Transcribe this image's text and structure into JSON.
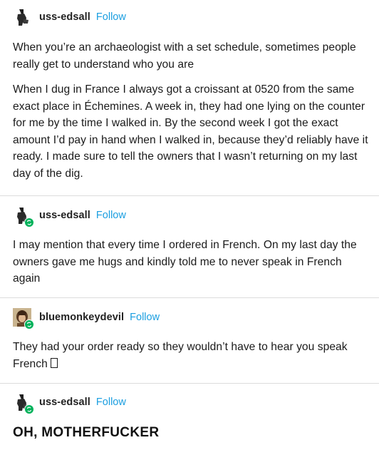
{
  "posts": [
    {
      "username": "uss-edsall",
      "follow_label": "Follow",
      "avatar_icon": "dark-figure-avatar-icon",
      "reblogged": false,
      "paragraphs": [
        "When you’re an archaeologist with a set schedule, sometimes people really get to understand who you are",
        "When I dug in France I always got a croissant at 0520 from the same exact place in Échemines. A week in, they had one lying on the counter for me by the time I walked in. By the second week I got the exact amount I’d pay in hand when I walked in, because they’d reliably have it ready. I made sure to tell the owners that I wasn’t returning on my last day of the dig."
      ]
    },
    {
      "username": "uss-edsall",
      "follow_label": "Follow",
      "avatar_icon": "dark-figure-avatar-icon",
      "reblogged": true,
      "paragraphs": [
        "I may mention that every time I ordered in French. On my last day the owners gave me hugs and kindly told me to never speak in French again"
      ]
    },
    {
      "username": "bluemonkeydevil",
      "follow_label": "Follow",
      "avatar_icon": "character-portrait-avatar-icon",
      "reblogged": true,
      "paragraphs": [
        "They had your order ready so they wouldn’t have to hear you speak French"
      ],
      "trailing_glyph": "missing-emoji-box-icon"
    },
    {
      "username": "uss-edsall",
      "follow_label": "Follow",
      "avatar_icon": "dark-figure-avatar-icon",
      "reblogged": true,
      "headline": "OH, MOTHERFUCKER"
    }
  ],
  "colors": {
    "follow_link": "#1a9ee0",
    "reblog_badge": "#00b25b",
    "divider": "#dcdcdc",
    "text": "#1a1a1a"
  }
}
